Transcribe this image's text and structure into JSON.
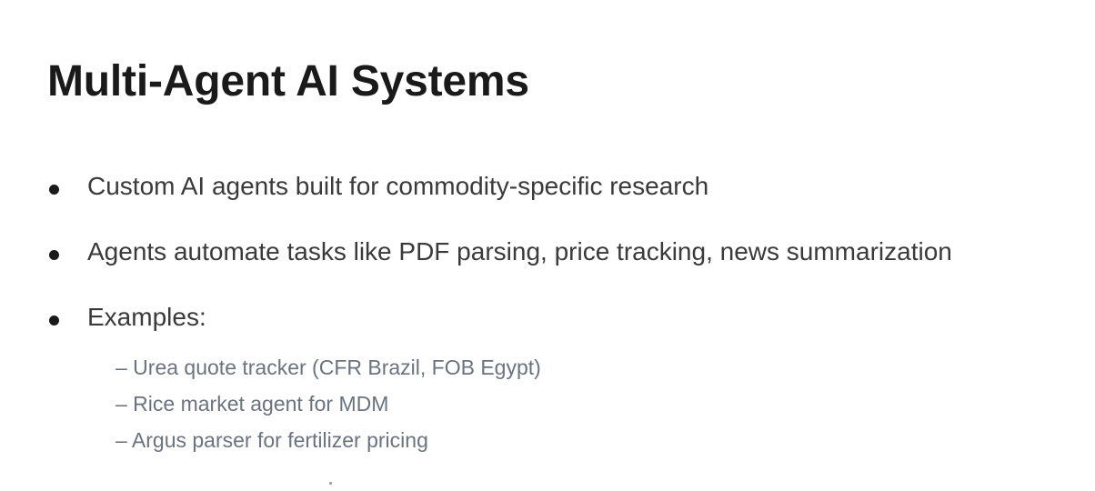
{
  "slide": {
    "title": "Multi-Agent AI Systems",
    "bullets": [
      {
        "text": "Custom AI agents built for commodity-specific research"
      },
      {
        "text": "Agents automate tasks like PDF parsing, price tracking, news summarization"
      },
      {
        "text": "Examples:"
      }
    ],
    "examples": [
      "– Urea quote tracker (CFR Brazil, FOB Egypt)",
      "– Rice market agent for MDM",
      "– Argus parser for fertilizer pricing"
    ]
  }
}
